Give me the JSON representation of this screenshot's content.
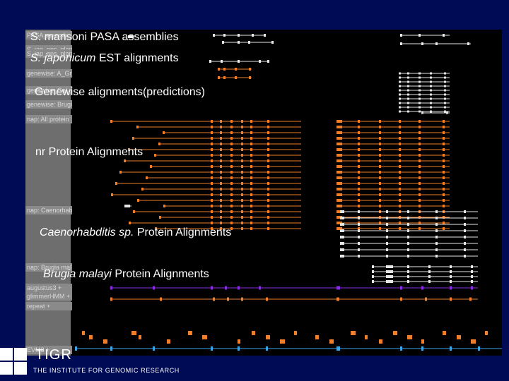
{
  "track_labels": {
    "pasa_a": "PASA assemb",
    "pasa_b": "S_jap_ans_plan",
    "jap_b": "S_jap_ans_plan",
    "gw_a": "genewise: A_Gr",
    "gw_b": "genewise: Cel",
    "gw_c": "genewise: Brugi",
    "nr": "nap: All protein",
    "cae": "nap: Caenorhab",
    "bru": "nap: Brugia mal",
    "aug": "augustus3 +",
    "glim": "glimmerHMM +",
    "rep": "repeat +",
    "evm": "EVM3 +"
  },
  "annotations": {
    "pasa": "S. mansoni PASA assemblies",
    "est_species": "S. japonicum",
    "est_rest": " EST alignments",
    "genewise": "Genewise alignments(predictions)",
    "nr": "nr Protein Alignments",
    "cae_species": "Caenorhabditis sp.",
    "cae_rest": " Protein Alignments",
    "bru_species": "Brugia malayi",
    "bru_rest": " Protein Alignments"
  },
  "footer": {
    "brand": "TIGR",
    "institute": "THE INSTITUTE FOR GENOMIC RESEARCH"
  },
  "colors": {
    "background": "#000b55",
    "feature_white": "#e6e6e6",
    "feature_orange": "#f07e2a",
    "feature_purple": "#8a2be2",
    "feature_blue": "#3aa6e8",
    "label_gray": "#8a8a8a"
  }
}
